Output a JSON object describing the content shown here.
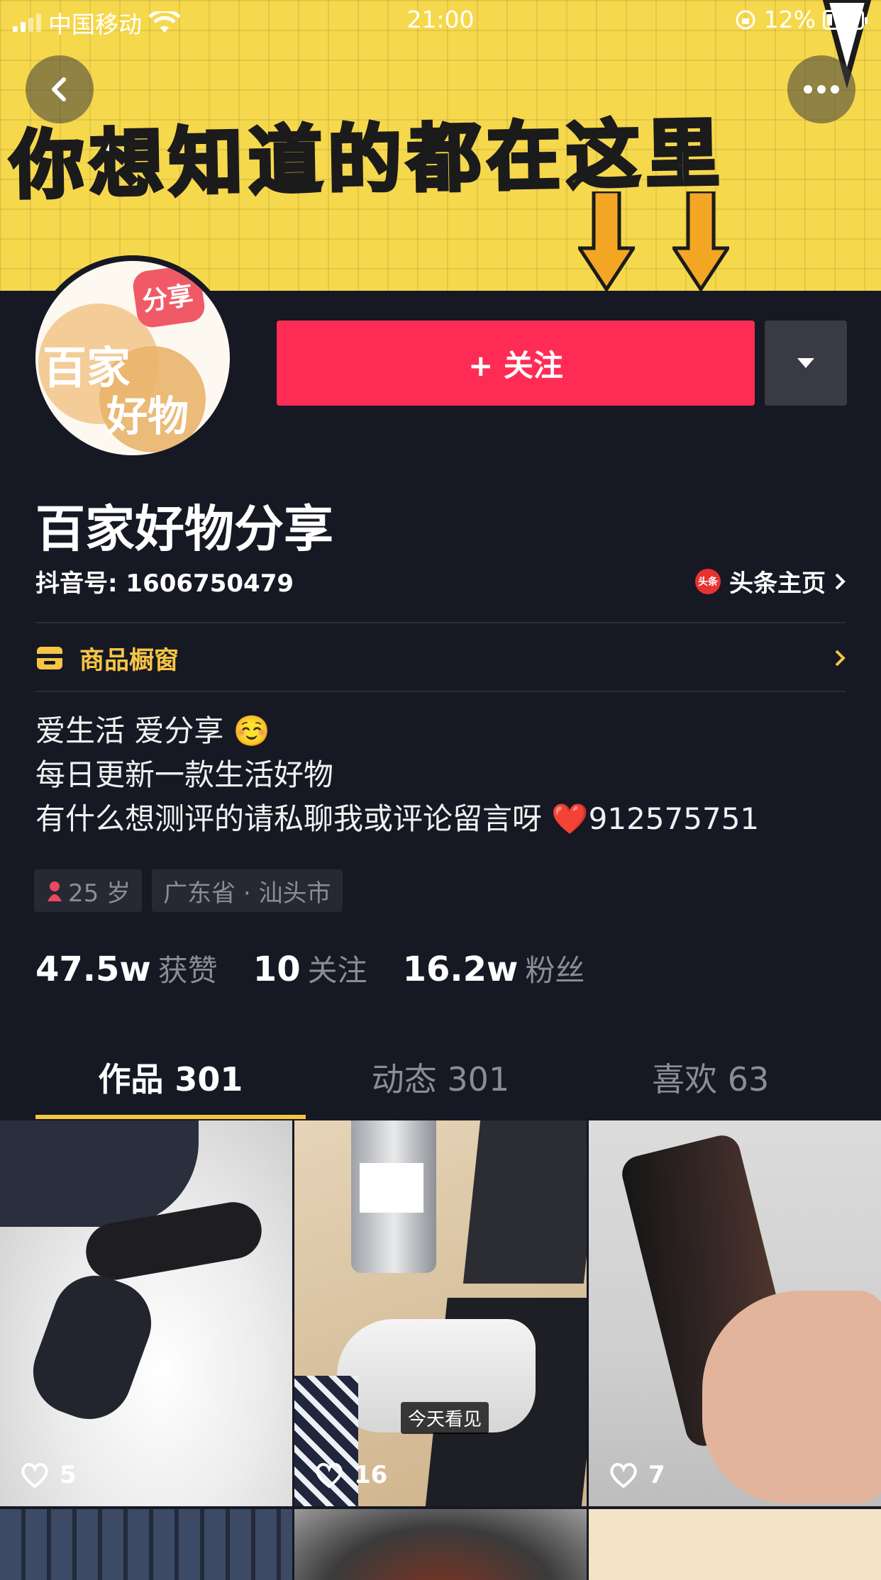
{
  "status_bar": {
    "carrier": "中国移动",
    "time": "21:00",
    "battery": "12%"
  },
  "banner": {
    "text": "你想知道的都在这里"
  },
  "avatar": {
    "badge_text": "分享",
    "line1": "百家",
    "line2": "好物"
  },
  "actions": {
    "follow_label": "+ 关注"
  },
  "profile": {
    "nickname": "百家好物分享",
    "douyin_id": "抖音号: 1606750479",
    "toutiao_link": "头条主页",
    "toutiao_badge": "头条",
    "shop_label": "商品橱窗",
    "bio": [
      "爱生活 爱分享 ☺️",
      "每日更新一款生活好物",
      "有什么想测评的请私聊我或评论留言呀 ❤️912575751"
    ],
    "tags": [
      "25 岁",
      "广东省 · 汕头市"
    ]
  },
  "stats": [
    {
      "num": "47.5w",
      "label": "获赞"
    },
    {
      "num": "10",
      "label": "关注"
    },
    {
      "num": "16.2w",
      "label": "粉丝"
    }
  ],
  "tabs": [
    {
      "label": "作品 301",
      "active": true
    },
    {
      "label": "动态 301",
      "active": false
    },
    {
      "label": "喜欢 63",
      "active": false
    }
  ],
  "videos": [
    {
      "likes": "5"
    },
    {
      "likes": "16",
      "badge": "今天看见"
    },
    {
      "likes": "7"
    }
  ],
  "colors": {
    "background": "#161823",
    "accent": "#fe2c55",
    "highlight": "#f6c544",
    "banner": "#f6d84d"
  }
}
